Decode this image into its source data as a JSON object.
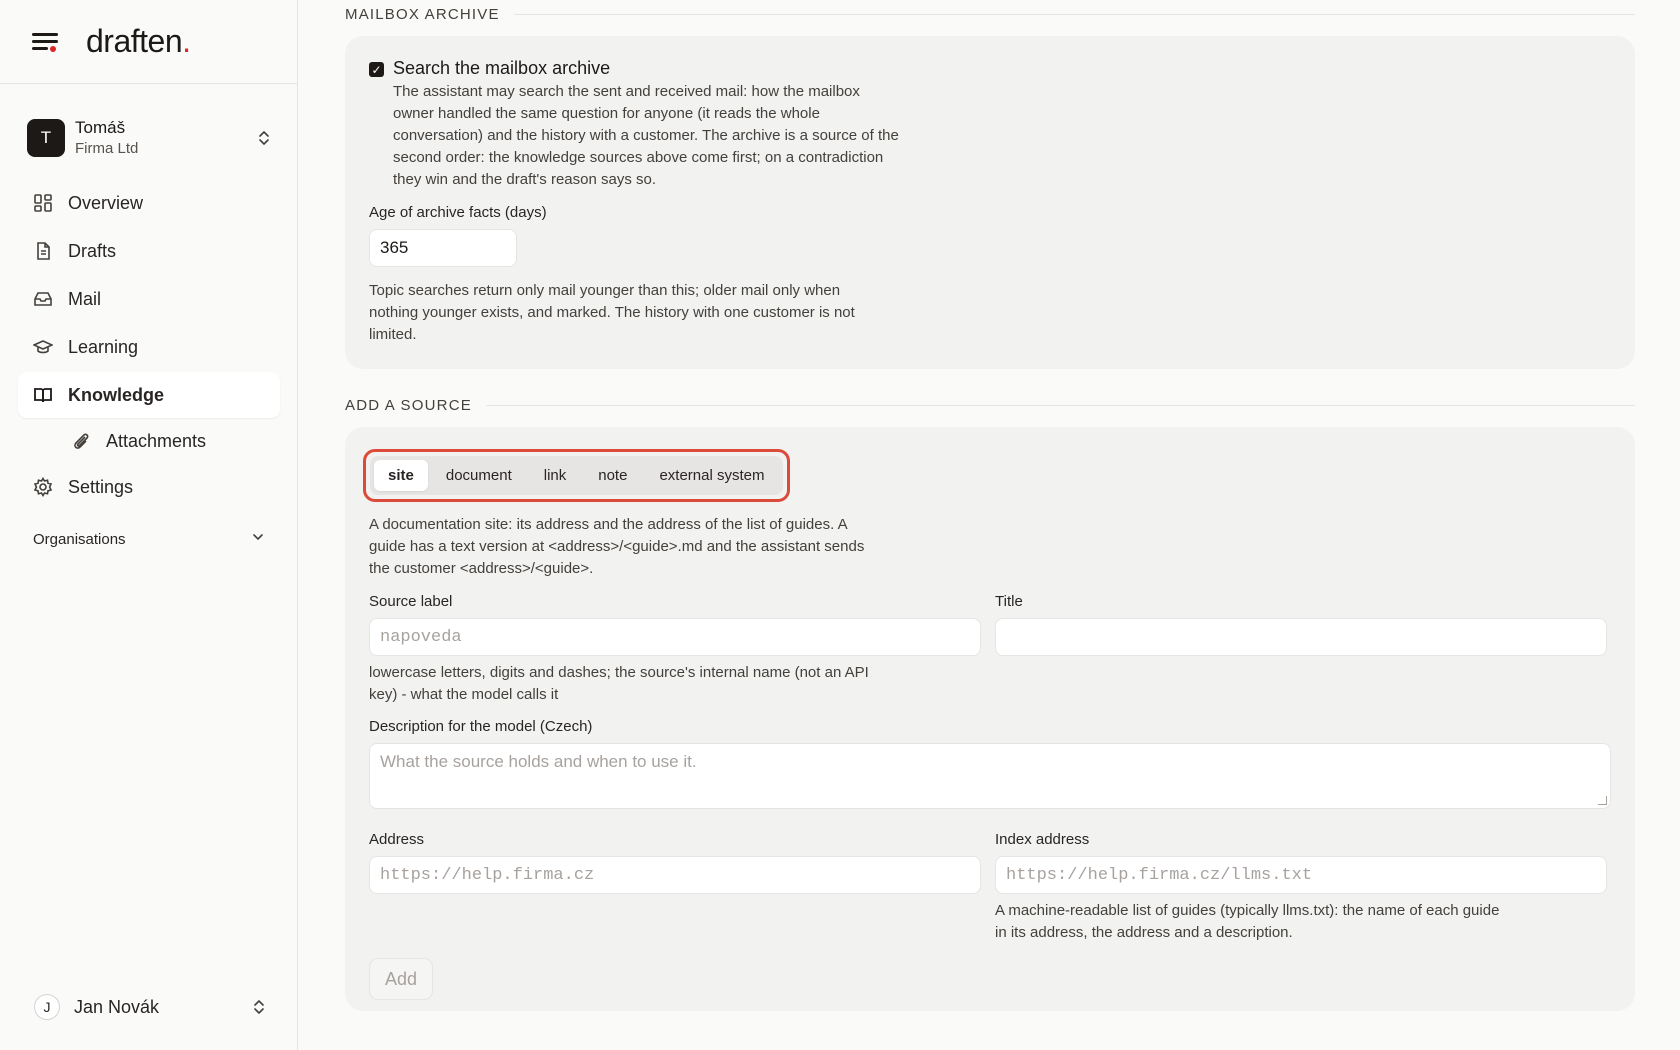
{
  "brand": {
    "name": "draften",
    "dot": "."
  },
  "account": {
    "initial": "T",
    "name": "Tomáš",
    "org": "Firma Ltd"
  },
  "nav": [
    {
      "label": "Overview",
      "icon": "grid-icon"
    },
    {
      "label": "Drafts",
      "icon": "document-icon"
    },
    {
      "label": "Mail",
      "icon": "inbox-icon"
    },
    {
      "label": "Learning",
      "icon": "graduation-cap-icon"
    },
    {
      "label": "Knowledge",
      "icon": "book-icon",
      "active": true
    },
    {
      "label": "Attachments",
      "icon": "paperclip-icon",
      "sub": true
    },
    {
      "label": "Settings",
      "icon": "gear-icon"
    }
  ],
  "organisations_label": "Organisations",
  "user": {
    "initial": "J",
    "name": "Jan Novák"
  },
  "archive": {
    "section_title": "MAILBOX ARCHIVE",
    "checkbox_label": "Search the mailbox archive",
    "checked": true,
    "description": "The assistant may search the sent and received mail: how the mailbox owner handled the same question for anyone (it reads the whole conversation) and the history with a customer. The archive is a source of the second order: the knowledge sources above come first; on a contradiction they win and the draft's reason says so.",
    "age_label": "Age of archive facts (days)",
    "age_value": "365",
    "age_help": "Topic searches return only mail younger than this; older mail only when nothing younger exists, and marked. The history with one customer is not limited."
  },
  "add_source": {
    "section_title": "ADD A SOURCE",
    "tabs": [
      "site",
      "document",
      "link",
      "note",
      "external system"
    ],
    "active_tab": "site",
    "type_help": "A documentation site: its address and the address of the list of guides. A guide has a text version at <address>/<guide>.md and the assistant sends the customer <address>/<guide>.",
    "source_label_label": "Source label",
    "source_label_placeholder": "napoveda",
    "source_label_help": "lowercase letters, digits and dashes; the source's internal name (not an API key) - what the model calls it",
    "title_label": "Title",
    "title_value": "",
    "description_label": "Description for the model (Czech)",
    "description_placeholder": "What the source holds and when to use it.",
    "address_label": "Address",
    "address_placeholder": "https://help.firma.cz",
    "index_label": "Index address",
    "index_placeholder": "https://help.firma.cz/llms.txt",
    "index_help": "A machine-readable list of guides (typically llms.txt): the name of each guide in its address, the address and a description.",
    "add_button": "Add"
  },
  "colors": {
    "accent": "#dc2626",
    "highlight": "#dc4a3a",
    "text": "#1c1917",
    "card": "#f2f2f1"
  }
}
